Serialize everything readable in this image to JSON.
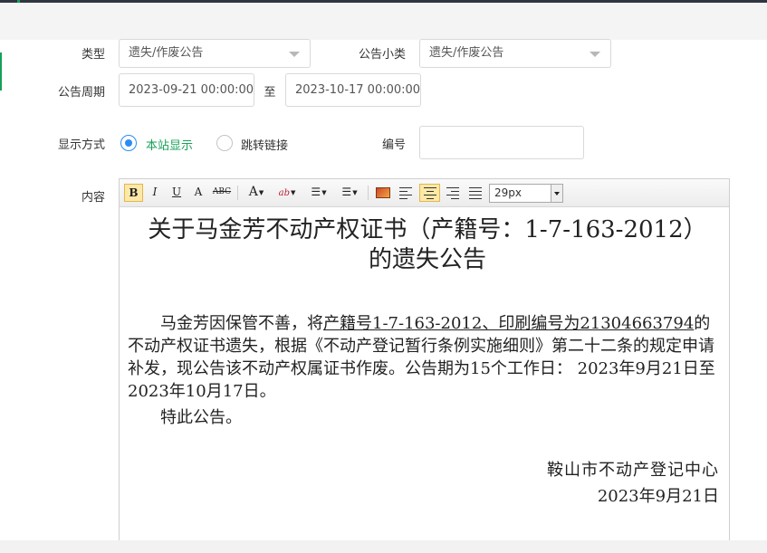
{
  "form": {
    "type_label": "类型",
    "type_value": "遗失/作废公告",
    "subtype_label": "公告小类",
    "subtype_value": "遗失/作废公告",
    "period_label": "公告周期",
    "period_start": "2023-09-21 00:00:00",
    "period_to": "至",
    "period_end": "2023-10-17 00:00:00",
    "display_label": "显示方式",
    "display_options": [
      "本站显示",
      "跳转链接"
    ],
    "display_selected": "本站显示",
    "number_label": "编号",
    "number_value": "",
    "content_label": "内容"
  },
  "toolbar": {
    "bold": "B",
    "italic": "I",
    "underline": "U",
    "border_text": "A",
    "strike": "ABC",
    "font_color": "A",
    "highlight": "ab",
    "font_size": "29px"
  },
  "document": {
    "title": "关于马金芳不动产权证书（产籍号：1-7-163-2012）的遗失公告",
    "body_pre": "马金芳因保管不善，将",
    "body_underlined": "产籍号1-7-163-2012、印刷编号为21304663794",
    "body_post": "的不动产权证书遗失，根据《不动产登记暂行条例实施细则》第二十二条的规定申请补发，现公告该不动产权属证书作废。公告期为15个工作日：  2023年9月21日至2023年10月17日。",
    "closing": "特此公告。",
    "signature_org": "鞍山市不动产登记中心",
    "signature_date": "2023年9月21日"
  },
  "colors": {
    "accent_green": "#18a058",
    "radio_blue": "#2d8cf0",
    "selected_text_green": "#18a058"
  }
}
